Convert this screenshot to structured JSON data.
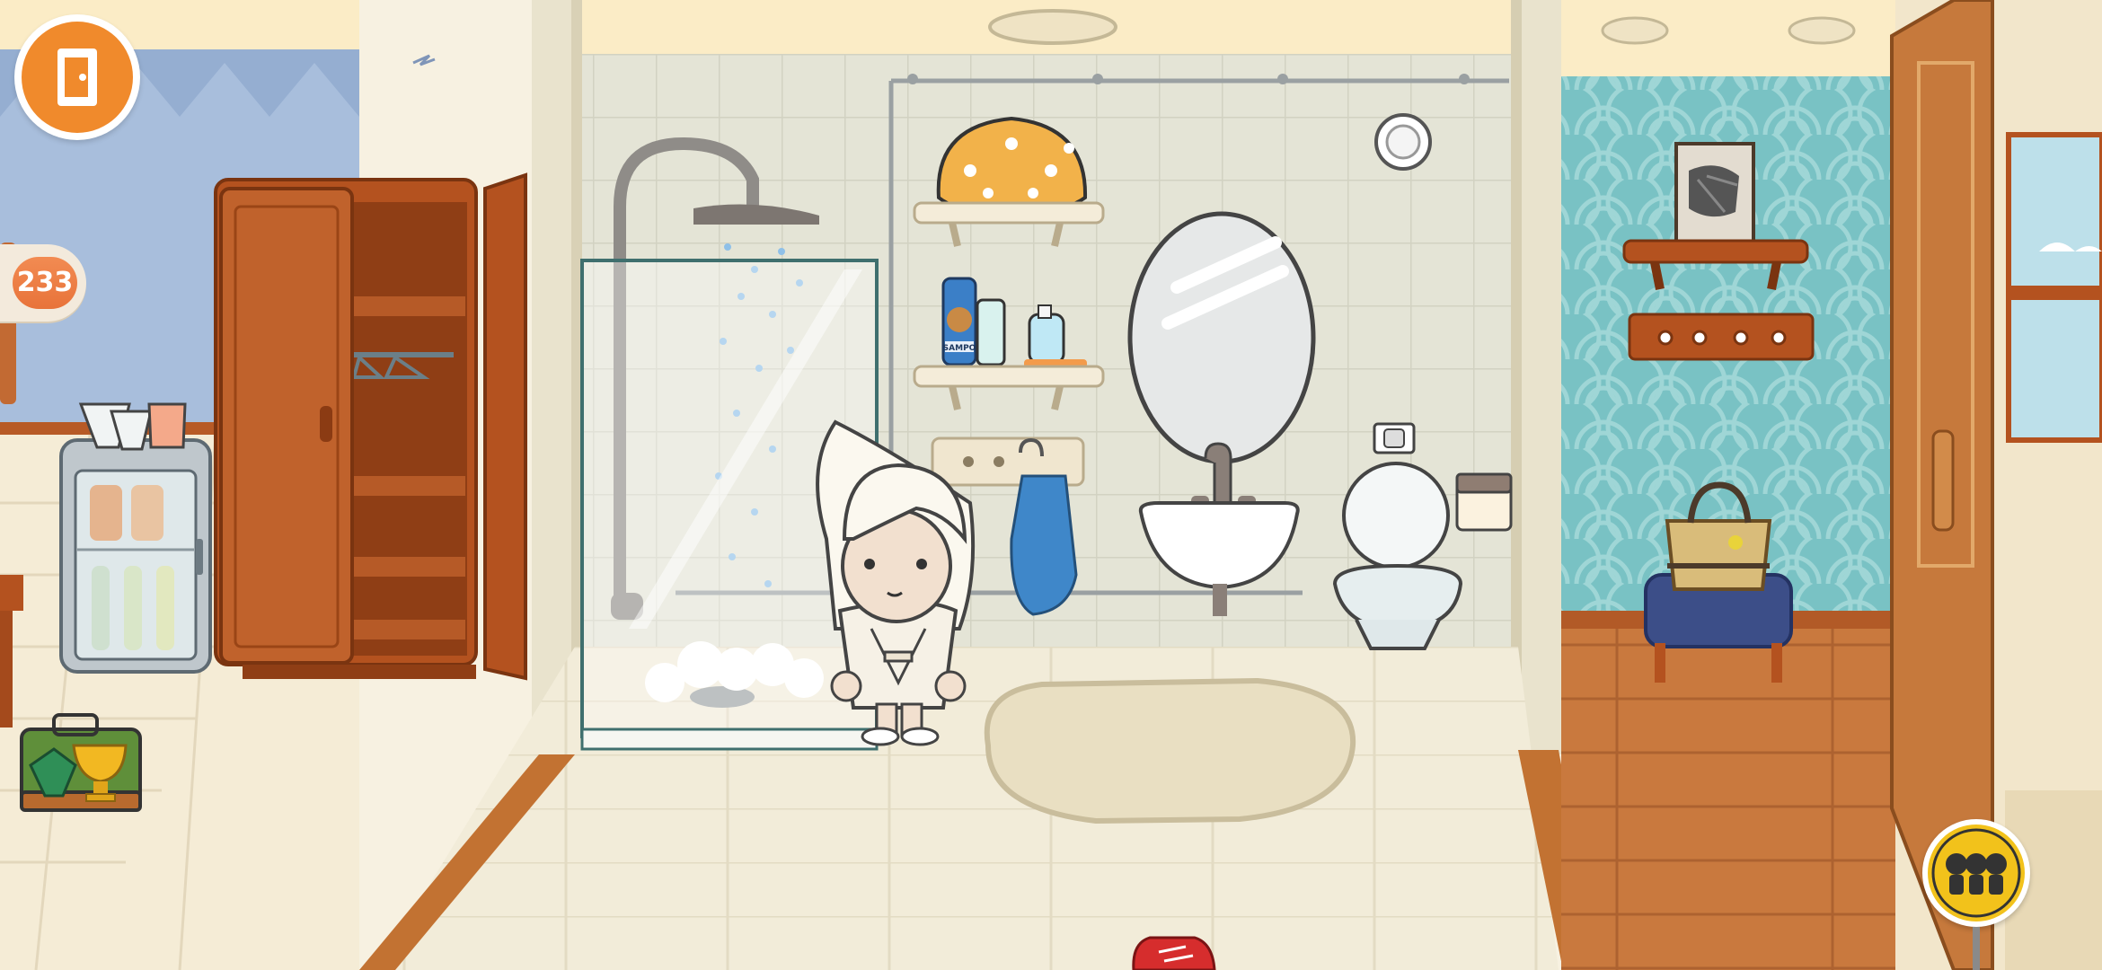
{
  "hud": {
    "exit_button": {
      "icon": "exit-door-icon",
      "accent": "#f08a2c"
    },
    "counter_badge": {
      "value": "233",
      "color": "#e8733a"
    },
    "characters_button": {
      "icon": "three-characters-icon",
      "accent": "#f2c21b"
    },
    "achievements_button": {
      "icons": [
        "gem-icon",
        "trophy-icon"
      ]
    }
  },
  "shampoo_bottle": {
    "label": "SAMPO"
  },
  "colors": {
    "wall_blue": "#a9bfdc",
    "wall_bathroom": "#e3e3d3",
    "wall_teal": "#7fc7c8",
    "floor_wood": "#c8773c",
    "floor_tile": "#efe8d3",
    "wardrobe": "#b4521f",
    "ceiling": "#fbecc6"
  }
}
